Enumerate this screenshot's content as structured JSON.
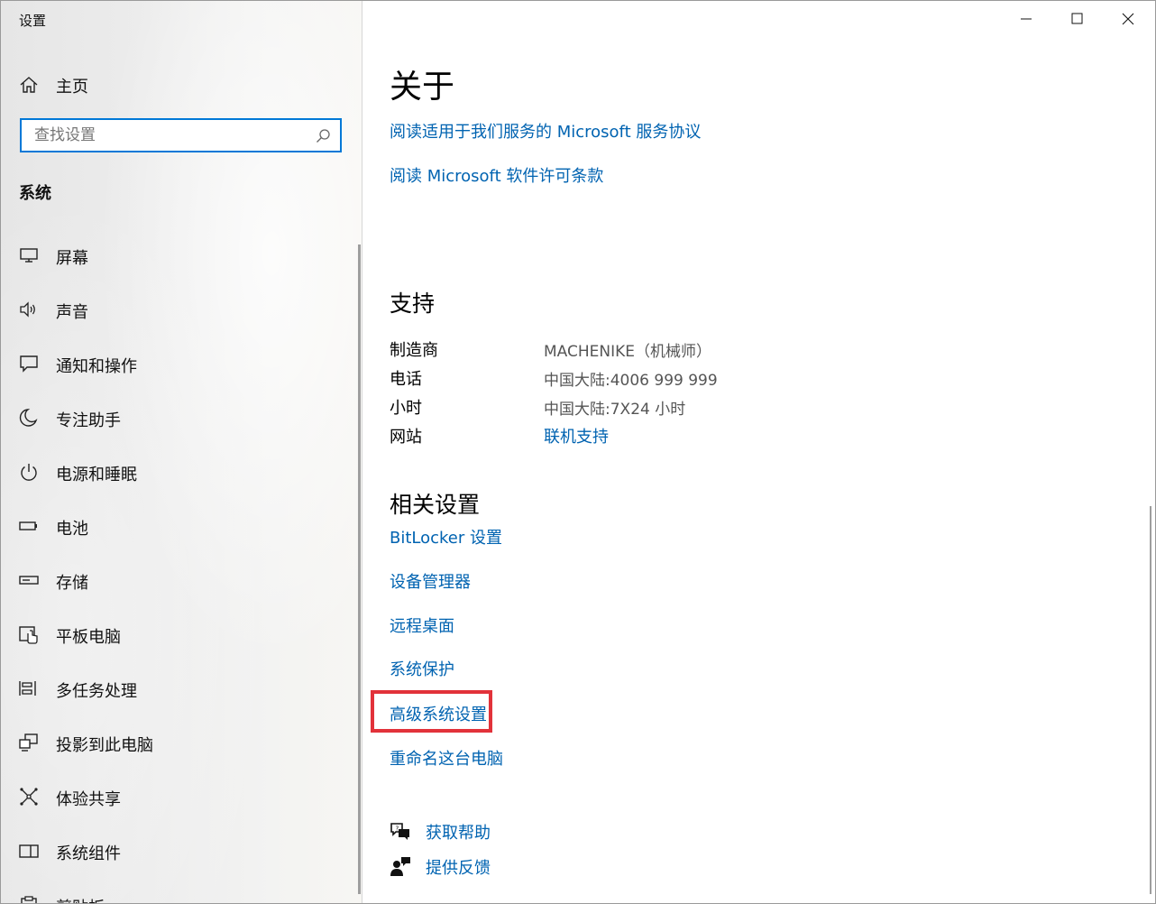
{
  "window": {
    "title": "设置"
  },
  "sidebar": {
    "home_label": "主页",
    "search": {
      "placeholder": "查找设置",
      "value": ""
    },
    "section_title": "系统",
    "items": [
      {
        "label": "屏幕",
        "icon": "monitor-icon"
      },
      {
        "label": "声音",
        "icon": "speaker-icon"
      },
      {
        "label": "通知和操作",
        "icon": "notification-icon"
      },
      {
        "label": "专注助手",
        "icon": "moon-icon"
      },
      {
        "label": "电源和睡眠",
        "icon": "power-icon"
      },
      {
        "label": "电池",
        "icon": "battery-icon"
      },
      {
        "label": "存储",
        "icon": "storage-icon"
      },
      {
        "label": "平板电脑",
        "icon": "tablet-icon"
      },
      {
        "label": "多任务处理",
        "icon": "multitask-icon"
      },
      {
        "label": "投影到此电脑",
        "icon": "project-icon"
      },
      {
        "label": "体验共享",
        "icon": "share-icon"
      },
      {
        "label": "系统组件",
        "icon": "components-icon"
      },
      {
        "label": "剪贴板",
        "icon": "clipboard-icon"
      }
    ]
  },
  "main": {
    "title": "关于",
    "top_links": [
      "阅读适用于我们服务的 Microsoft 服务协议",
      "阅读 Microsoft 软件许可条款"
    ],
    "support": {
      "heading": "支持",
      "rows": [
        {
          "label": "制造商",
          "value": "MACHENIKE（机械师）"
        },
        {
          "label": "电话",
          "value": "中国大陆:4006 999 999"
        },
        {
          "label": "小时",
          "value": "中国大陆:7X24 小时"
        },
        {
          "label": "网站",
          "value": "联机支持"
        }
      ]
    },
    "related": {
      "heading": "相关设置",
      "links": [
        "BitLocker 设置",
        "设备管理器",
        "远程桌面",
        "系统保护",
        "高级系统设置",
        "重命名这台电脑"
      ]
    },
    "help": {
      "get_help": "获取帮助",
      "feedback": "提供反馈"
    }
  },
  "colors": {
    "accent": "#0078d7",
    "link": "#0063b1",
    "highlight": "#e2323a"
  }
}
